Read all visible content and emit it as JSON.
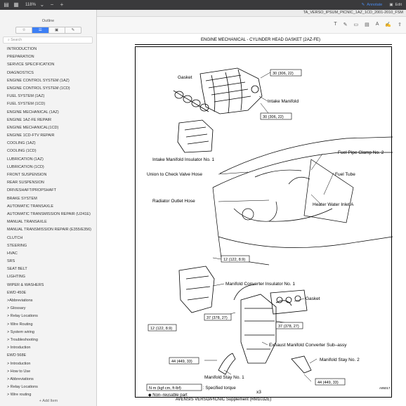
{
  "toolbar": {
    "zoom": "118%",
    "annotate_label": "Annotate",
    "edit_label": "Edit"
  },
  "document": {
    "filename": "TA_VERSO_IPSUM_PICNIC_1AZ_1CD_2001-2010_FSM",
    "header": "ENGINE MECHANICAL  -   CYLINDER HEAD GASKET (2AZ-FE)",
    "footer": "AVENSIS VERSO/PICNIC Supplement   (RM1032E)",
    "diagram_code": "A95017"
  },
  "sidebar": {
    "title": "Outline",
    "search_placeholder": "Search",
    "add_item_label": "+ Add Item",
    "items": [
      "INTRODUCTION",
      "PREPARATION",
      "SERVICE SPECIFICATION",
      "DIAGNOSTICS",
      "ENGINE CONTROL SYSTEM (1AZ)",
      "ENGINE CONTROL SYSTEM (1CD)",
      "FUEL SYSTEM (1AZ)",
      "FUEL SYSTEM (1CD)",
      "ENGINE MECHANICAL (1AZ)",
      "ENGINE 1AZ-FE REPAIR",
      "ENGINE MECHANICAL(1CD)",
      "ENGINE 1CD-FTV REPAIR",
      "COOLING (1AZ)",
      "COOLING (1CD)",
      "LUBRICATION (1AZ)",
      "LUBRICATION (1CD)",
      "FRONT SUSPENSION",
      "REAR SUSPENSION",
      "DRIVESHAFT/PROPSHAFT",
      "BRAKE SYSTEM",
      "AUTOMATIC TRANSAXLE",
      "AUTOMATIC TRANSMISSION REPAIR (U241E)",
      "MANUAL TRANSAXLE",
      "MANUAL TRANSMISSION REPAIR (E355/E356)",
      "CLUTCH",
      "STEERING",
      "HVAC",
      "SRS",
      "SEAT BELT",
      "LIGHTING",
      "WIPER & WASHERS",
      "EWD 450E",
      ">Abbreviations",
      "> Glossary",
      "> Relay Locations",
      "> Wire Routing",
      "> System wiring",
      "> Troubleshooting",
      "> Introduction",
      "EWD 568E",
      "> Introduction",
      "> How to Use",
      "> Abbreviations",
      "> Relay Locations",
      "> Wire routing"
    ]
  },
  "diagram": {
    "labels": {
      "gasket_top": "Gasket",
      "torque_top_1": "30 (306, 22)",
      "intake_manifold": "Intake Manifold",
      "torque_top_2": "30 (306, 22)",
      "intake_insulator": "Intake Manifold Insulator No. 1",
      "fuel_clamp": "Fuel Pipe Clamp No. 2",
      "union": "Union to Check Valve Hose",
      "fuel_tube": "Fuel Tube",
      "radiator_hose": "Radiator Outlet Hose",
      "heater_inlet": "Heater Water Inlet A",
      "torque_mid_1": "12 (122, 8.9)",
      "mc_insulator": "Manifold Converter Insulator No. 1",
      "gasket_mid": "Gasket",
      "torque_mid_2": "37 (378, 27)",
      "torque_mid_3": "37 (378, 27)",
      "torque_mid_4": "12 (122, 8.9)",
      "exhaust_converter": "Exhaust Manifold Converter Sub–assy",
      "torque_low_1": "44 (449, 33)",
      "manifold_stay_2": "Manifold Stay No. 2",
      "manifold_stay_1": "Manifold Stay No. 1",
      "torque_low_2": "44 (449, 33)",
      "x3": "x3",
      "legend_units": "N·m (kgf·cm, ft·lbf)",
      "legend_torque": ": Specified torque",
      "legend_nonreuse": "◆ Non–reusable part"
    }
  }
}
